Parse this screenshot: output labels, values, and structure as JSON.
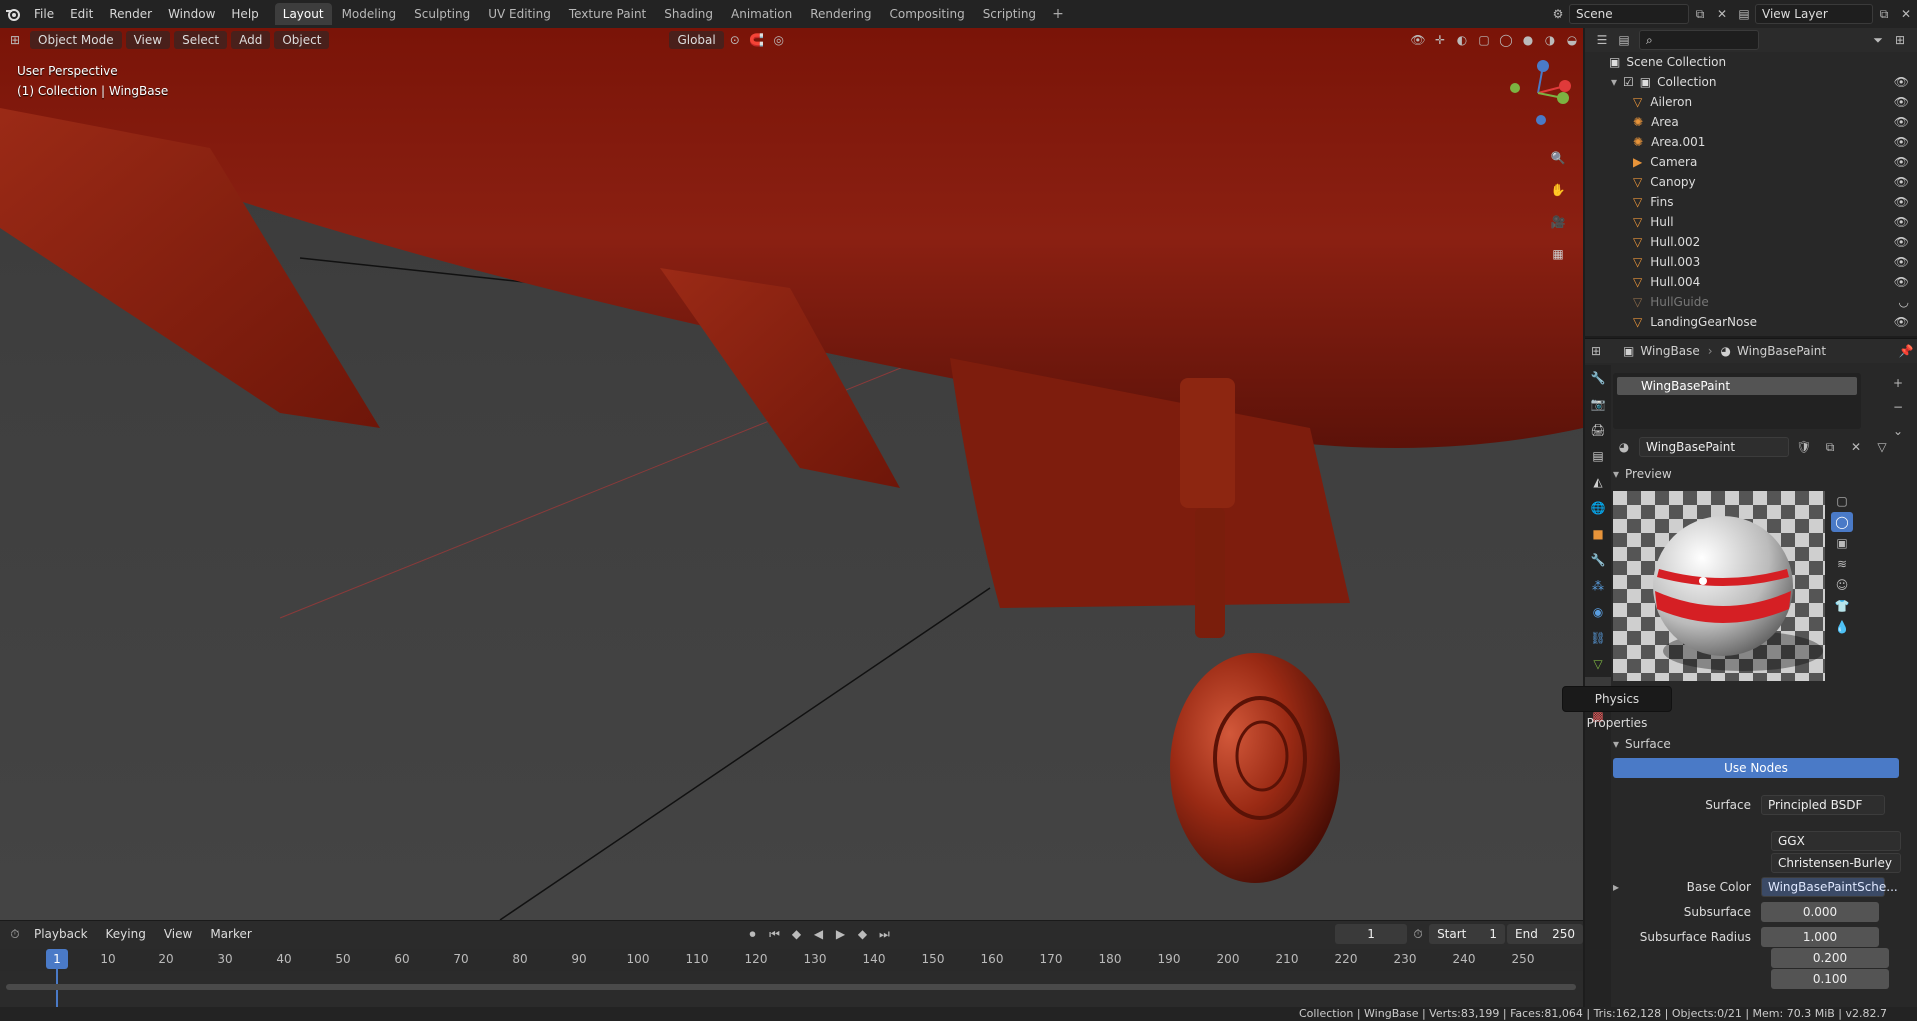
{
  "menu": {
    "file": "File",
    "edit": "Edit",
    "render": "Render",
    "window": "Window",
    "help": "Help"
  },
  "workspaces": [
    "Layout",
    "Modeling",
    "Sculpting",
    "UV Editing",
    "Texture Paint",
    "Shading",
    "Animation",
    "Rendering",
    "Compositing",
    "Scripting"
  ],
  "active_workspace": "Layout",
  "scene": {
    "name": "Scene",
    "view_layer": "View Layer"
  },
  "viewport": {
    "mode": "Object Mode",
    "view": "View",
    "select": "Select",
    "add": "Add",
    "object": "Object",
    "orientation": "Global",
    "info_line1": "User Perspective",
    "info_line2": "(1) Collection | WingBase"
  },
  "outliner": {
    "scene_collection": "Scene Collection",
    "collection": "Collection",
    "items": [
      {
        "name": "Aileron",
        "hidden": false
      },
      {
        "name": "Area",
        "hidden": false
      },
      {
        "name": "Area.001",
        "hidden": false
      },
      {
        "name": "Camera",
        "hidden": false
      },
      {
        "name": "Canopy",
        "hidden": false
      },
      {
        "name": "Fins",
        "hidden": false
      },
      {
        "name": "Hull",
        "hidden": false
      },
      {
        "name": "Hull.002",
        "hidden": false
      },
      {
        "name": "Hull.003",
        "hidden": false
      },
      {
        "name": "Hull.004",
        "hidden": false
      },
      {
        "name": "HullGuide",
        "hidden": true
      },
      {
        "name": "LandingGearNose",
        "hidden": false
      }
    ]
  },
  "properties": {
    "breadcrumb_object": "WingBase",
    "breadcrumb_material": "WingBasePaint",
    "slot_name": "WingBasePaint",
    "material_name": "WingBasePaint",
    "preview_label": "Preview",
    "surface_panel": "Surface",
    "use_nodes": "Use Nodes",
    "surface_label": "Surface",
    "surface_value": "Principled BSDF",
    "distribution": "GGX",
    "subsurface_method": "Christensen-Burley",
    "base_color_label": "Base Color",
    "base_color_value": "WingBasePaintSche...",
    "subsurface_label": "Subsurface",
    "subsurface_value": "0.000",
    "subsurface_radius_label": "Subsurface Radius",
    "subsurface_radius": [
      "1.000",
      "0.200",
      "0.100"
    ]
  },
  "tooltip": "Physics Properties",
  "timeline": {
    "playback": "Playback",
    "keying": "Keying",
    "view": "View",
    "marker": "Marker",
    "current_frame": "1",
    "start_label": "Start",
    "start": "1",
    "end_label": "End",
    "end": "250",
    "ticks": [
      "10",
      "20",
      "30",
      "40",
      "50",
      "60",
      "70",
      "80",
      "90",
      "100",
      "110",
      "120",
      "130",
      "140",
      "150",
      "160",
      "170",
      "180",
      "190",
      "200",
      "210",
      "220",
      "230",
      "240",
      "250"
    ],
    "cursor": "1"
  },
  "statusbar": "Collection | WingBase | Verts:83,199 | Faces:81,064 | Tris:162,128 | Objects:0/21 | Mem: 70.3 MiB | v2.82.7"
}
